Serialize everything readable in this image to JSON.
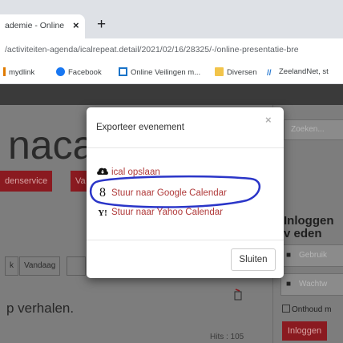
{
  "browser": {
    "tab_title": "ademie - Online",
    "tab_close": "×",
    "new_tab": "+",
    "url": "/activiteiten-agenda/icalrepeat.detail/2021/02/16/28325/-/online-presentatie-bre",
    "bookmarks": [
      "mydlink",
      "Facebook",
      "Online Veilingen m...",
      "Diversen",
      "ZeelandNet, st"
    ]
  },
  "page": {
    "site_title": "naca",
    "red_button_1": "denservice",
    "red_button_2": "Va",
    "search_placeholder": "Zoeken...",
    "login_heading": "Inloggen v eden",
    "username_placeholder": "Gebruik",
    "password_placeholder": "Wachtw",
    "remember_label": "Onthoud m",
    "login_button": "Inloggen",
    "calendar_buttons": [
      "k",
      "Vandaag",
      ""
    ],
    "heading": "p verhalen.",
    "hits": "Hits : 105"
  },
  "modal": {
    "title": "Exporteer evenement",
    "close_x": "×",
    "options": [
      {
        "icon": "ical-icon",
        "label": "ical opslaan"
      },
      {
        "icon": "google-icon",
        "glyph": "8",
        "label": "Stuur naar Google Calendar"
      },
      {
        "icon": "yahoo-icon",
        "glyph": "Y!",
        "label": "Stuur naar Yahoo Calendar"
      }
    ],
    "close_button": "Sluiten"
  },
  "colors": {
    "link_red": "#b03a3a",
    "annotation_blue": "#2a35c8",
    "brand_red": "#8a1a20"
  }
}
